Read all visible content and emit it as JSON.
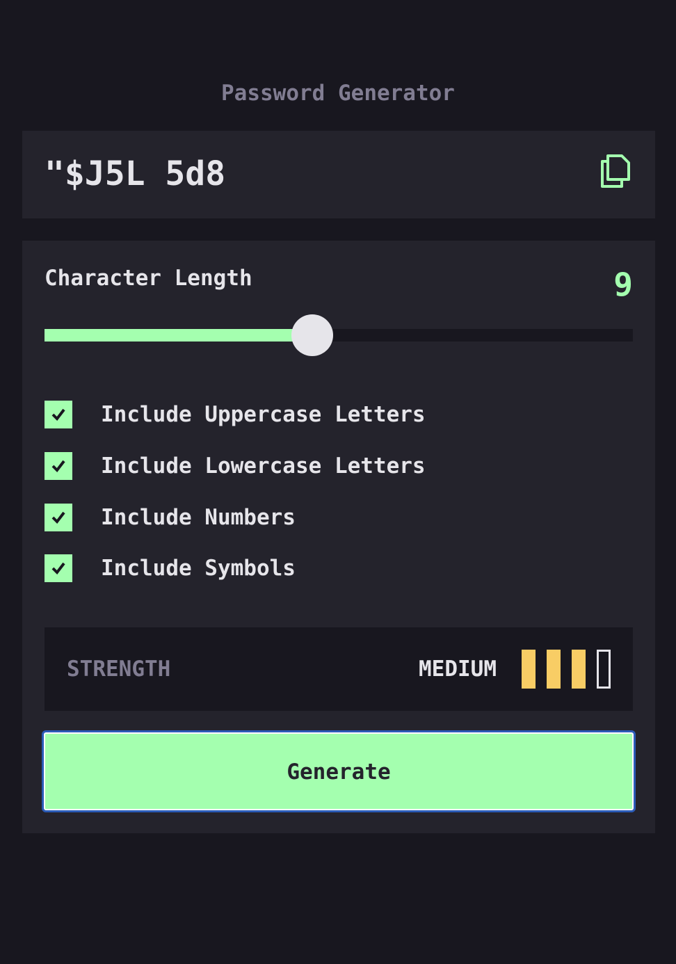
{
  "app": {
    "title": "Password Generator"
  },
  "output": {
    "password": "\"$J5L 5d8",
    "copy_icon": "copy-icon"
  },
  "length": {
    "label": "Character Length",
    "value": "9",
    "fraction": 0.455
  },
  "options": [
    {
      "label": "Include Uppercase Letters",
      "checked": true
    },
    {
      "label": "Include Lowercase Letters",
      "checked": true
    },
    {
      "label": "Include Numbers",
      "checked": true
    },
    {
      "label": "Include Symbols",
      "checked": true
    }
  ],
  "strength": {
    "label": "STRENGTH",
    "level": "MEDIUM",
    "bars_filled": 3,
    "bars_total": 4
  },
  "generate": {
    "label": "Generate"
  },
  "colors": {
    "accent": "#a4ffaf",
    "strength_medium": "#f8cd65",
    "background": "#18171f",
    "panel": "#24232c"
  }
}
